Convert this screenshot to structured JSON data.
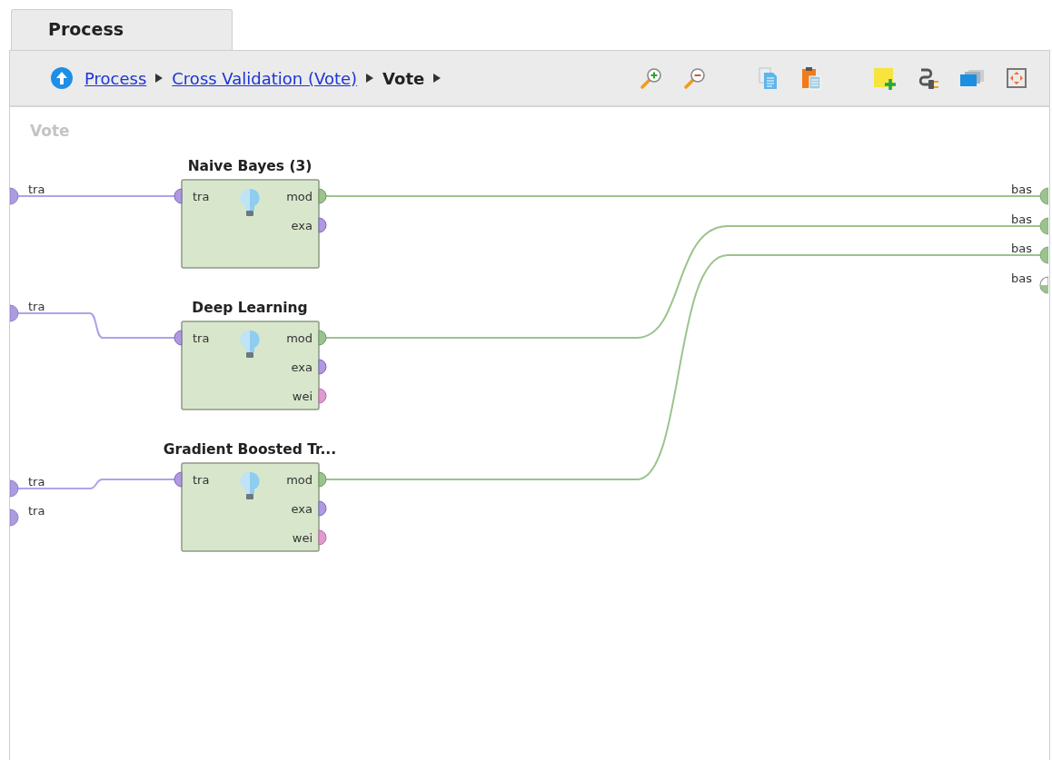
{
  "tab": {
    "label": "Process",
    "selected": true
  },
  "breadcrumb": [
    {
      "label": "Process",
      "kind": "link"
    },
    {
      "label": "Cross Validation (Vote)",
      "kind": "link"
    },
    {
      "label": "Vote",
      "kind": "current"
    }
  ],
  "canvas": {
    "title": "Vote",
    "sources": [
      {
        "label": "tra"
      },
      {
        "label": "tra"
      },
      {
        "label": "tra"
      },
      {
        "label": "tra"
      }
    ],
    "operators": [
      {
        "name": "Naive Bayes (3)",
        "input": "tra",
        "outputs": [
          {
            "label": "mod",
            "kind": "model"
          },
          {
            "label": "exa",
            "kind": "example"
          }
        ]
      },
      {
        "name": "Deep Learning",
        "input": "tra",
        "outputs": [
          {
            "label": "mod",
            "kind": "model"
          },
          {
            "label": "exa",
            "kind": "example"
          },
          {
            "label": "wei",
            "kind": "weights"
          }
        ]
      },
      {
        "name": "Gradient Boosted Tr...",
        "input": "tra",
        "outputs": [
          {
            "label": "mod",
            "kind": "model"
          },
          {
            "label": "exa",
            "kind": "example"
          },
          {
            "label": "wei",
            "kind": "weights"
          }
        ]
      }
    ],
    "sinks": [
      {
        "label": "bas",
        "connected": true
      },
      {
        "label": "bas",
        "connected": true
      },
      {
        "label": "bas",
        "connected": true
      },
      {
        "label": "bas",
        "connected": false
      }
    ]
  }
}
